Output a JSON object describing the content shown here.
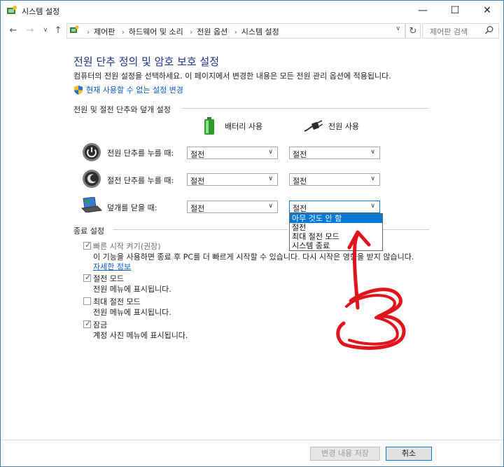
{
  "window": {
    "title": "시스템 설정",
    "min_icon": "minimize-icon",
    "max_icon": "maximize-icon",
    "close_icon": "close-icon"
  },
  "address": {
    "crumbs": [
      "제어판",
      "하드웨어 및 소리",
      "전원 옵션",
      "시스템 설정"
    ],
    "search_placeholder": "제어판 검색"
  },
  "main": {
    "title": "전원 단추 정의 및 암호 보호 설정",
    "description": "컴퓨터의 전원 설정을 선택하세요. 이 페이지에서 변경한 내용은 모든 전원 관리 옵션에 적용됩니다.",
    "unavailable_link": "현재 사용할 수 없는 설정 변경"
  },
  "buttons_section": {
    "title": "전원 및 절전 단추와 덮개 설정",
    "col_battery": "배터리 사용",
    "col_power": "전원 사용",
    "rows": [
      {
        "label": "전원 단추를 누를 때:",
        "battery": "절전",
        "power": "절전"
      },
      {
        "label": "절전 단추를 누를 때:",
        "battery": "절전",
        "power": "절전"
      },
      {
        "label": "덮개를 닫을 때:",
        "battery": "절전",
        "power": "절전"
      }
    ],
    "dropdown_options": [
      "아무 것도 안 함",
      "절전",
      "최대 절전 모드",
      "시스템 종료"
    ]
  },
  "shutdown_section": {
    "title": "종료 설정",
    "fast_startup": {
      "label": "빠른 시작 켜기(권장)",
      "desc": "이 기능을 사용하면 종료 후 PC를 더 빠르게 시작할 수 있습니다. 다시 시작은 영향을 받지 않습니다.",
      "link": "자세한 정보",
      "checked": true
    },
    "sleep": {
      "label": "절전 모드",
      "desc": "전원 메뉴에 표시됩니다.",
      "checked": true
    },
    "hibernate": {
      "label": "최대 절전 모드",
      "desc": "전원 메뉴에 표시됩니다.",
      "checked": false
    },
    "lock": {
      "label": "잠금",
      "desc": "계정 사진 메뉴에 표시됩니다.",
      "checked": true
    }
  },
  "footer": {
    "save": "변경 내용 저장",
    "cancel": "취소"
  },
  "colors": {
    "heading": "#1e3287",
    "link": "#0b5cbf",
    "selection": "#0078d7",
    "annotation": "#e0141c"
  }
}
